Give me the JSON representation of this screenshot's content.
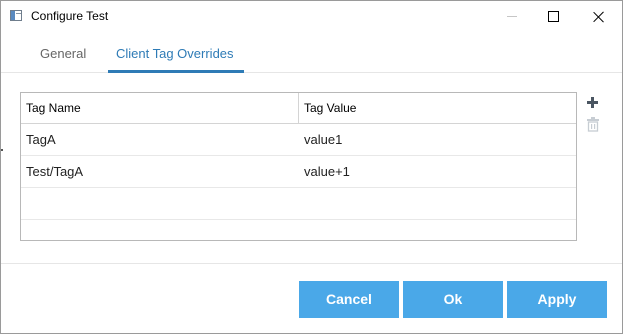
{
  "window": {
    "title": "Configure Test"
  },
  "tabs": [
    {
      "label": "General",
      "active": false
    },
    {
      "label": "Client Tag Overrides",
      "active": true
    }
  ],
  "table": {
    "columns": [
      "Tag Name",
      "Tag Value"
    ],
    "rows": [
      {
        "name": "TagA",
        "value": "value1"
      },
      {
        "name": "Test/TagA",
        "value": "value+1"
      }
    ]
  },
  "icons": {
    "app": "app-window-icon",
    "add": "plus-icon",
    "delete": "trash-icon",
    "minimize": "minimize-icon",
    "maximize": "maximize-icon",
    "close": "close-icon"
  },
  "buttons": {
    "cancel": "Cancel",
    "ok": "Ok",
    "apply": "Apply"
  },
  "colors": {
    "accent": "#2e7bb6",
    "button": "#4aa8e8",
    "button_text": "#ffffff",
    "tool_icon": "#4a5561",
    "tool_icon_disabled": "#c7cdd3"
  }
}
